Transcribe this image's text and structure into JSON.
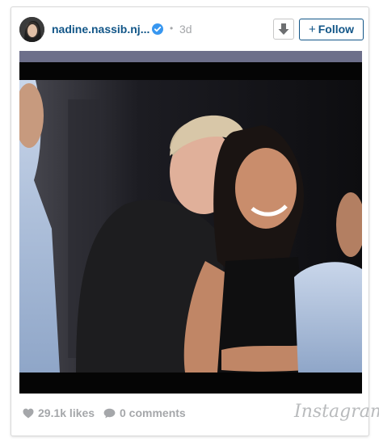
{
  "post": {
    "username": "nadine.nassib.nj...",
    "separator": "•",
    "time_ago": "3d",
    "follow_label": "Follow",
    "likes": "29.1k likes",
    "comments": "0 comments",
    "brand": "Instagram"
  },
  "icons": {
    "verified": "verified-badge-icon",
    "download": "download-arrow-icon",
    "follow_plus": "plus-icon",
    "like": "heart-icon",
    "comment": "speech-bubble-icon"
  },
  "colors": {
    "link_blue": "#125688",
    "verified_blue": "#3897f0",
    "muted_gray": "#a5a7aa"
  }
}
